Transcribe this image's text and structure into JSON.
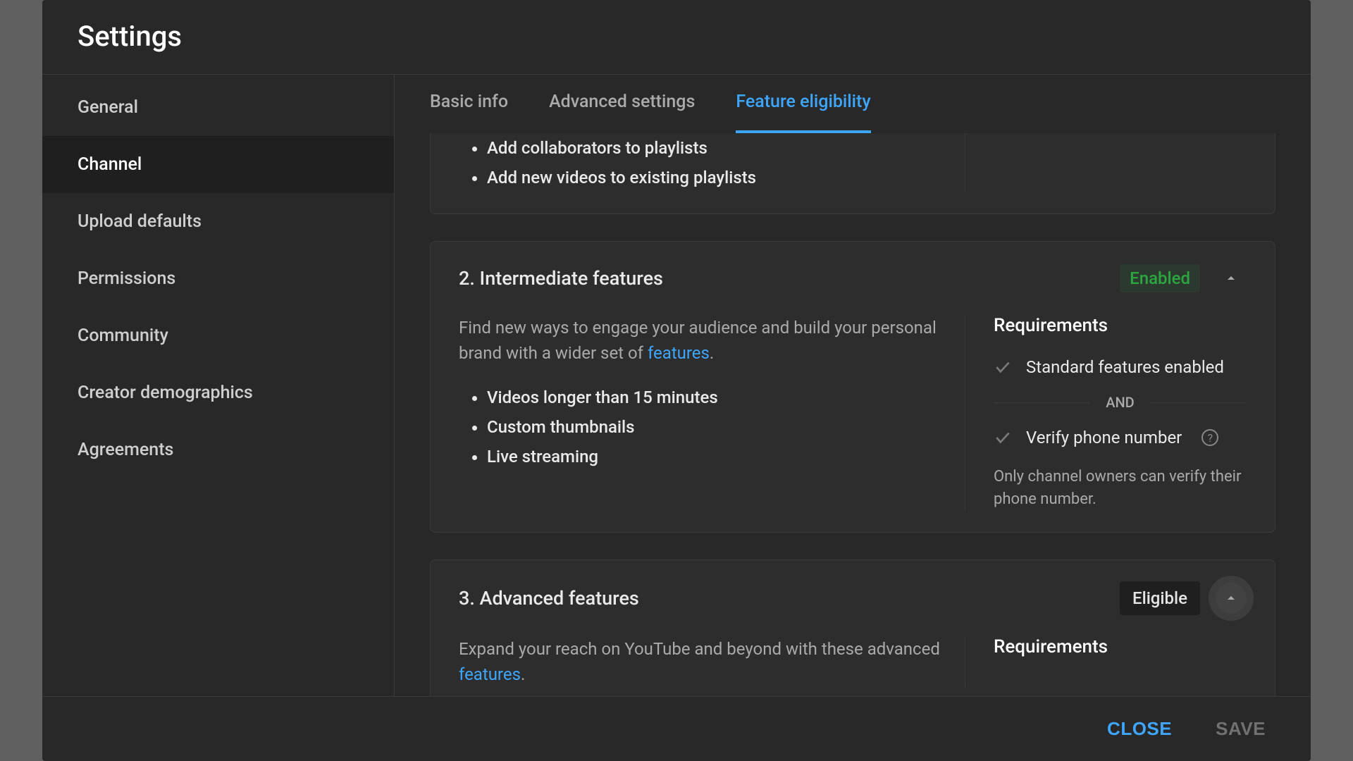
{
  "title": "Settings",
  "sidebar": {
    "items": [
      {
        "label": "General"
      },
      {
        "label": "Channel"
      },
      {
        "label": "Upload defaults"
      },
      {
        "label": "Permissions"
      },
      {
        "label": "Community"
      },
      {
        "label": "Creator demographics"
      },
      {
        "label": "Agreements"
      }
    ],
    "activeIndex": 1
  },
  "tabs": {
    "items": [
      {
        "label": "Basic info"
      },
      {
        "label": "Advanced settings"
      },
      {
        "label": "Feature eligibility"
      }
    ],
    "activeIndex": 2
  },
  "sections": {
    "partial": {
      "bullets": [
        "Add collaborators to playlists",
        "Add new videos to existing playlists"
      ]
    },
    "intermediate": {
      "title": "2. Intermediate features",
      "status": "Enabled",
      "desc_prefix": "Find new ways to engage your audience and build your personal brand with a wider set of ",
      "desc_link": "features",
      "desc_suffix": ".",
      "bullets": [
        "Videos longer than 15 minutes",
        "Custom thumbnails",
        "Live streaming"
      ],
      "req_title": "Requirements",
      "req_1": "Standard features enabled",
      "and": "AND",
      "req_2": "Verify phone number",
      "note": "Only channel owners can verify their phone number."
    },
    "advanced": {
      "title": "3. Advanced features",
      "status": "Eligible",
      "desc_prefix": "Expand your reach on YouTube and beyond with these advanced ",
      "desc_link": "features",
      "desc_suffix": ".",
      "req_title": "Requirements"
    }
  },
  "footer": {
    "close": "CLOSE",
    "save": "SAVE"
  }
}
